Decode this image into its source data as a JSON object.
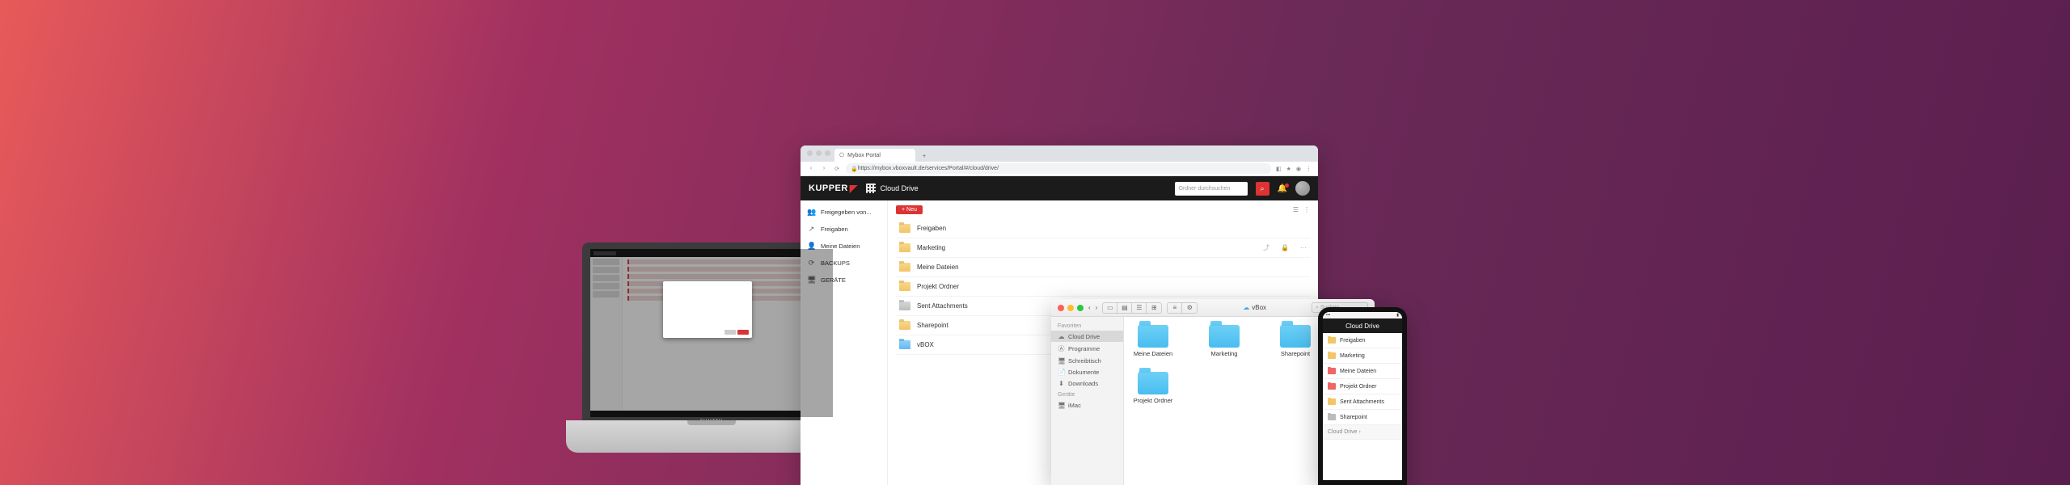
{
  "laptop": {
    "brand": "FUJITSU"
  },
  "browser": {
    "tab_title": "Mybox Portal",
    "url": "https://mybox.vboxvault.de/services/Portal/#/cloud/drive/",
    "window_controls": [
      "min",
      "max",
      "close"
    ]
  },
  "app": {
    "logo": "KUPPER",
    "title": "Cloud Drive",
    "search_placeholder": "Ordner durchsuchen",
    "new_button": "+ Neu"
  },
  "sidebar": {
    "items": [
      {
        "icon": "users",
        "label": "Freigegeben von..."
      },
      {
        "icon": "share",
        "label": "Freigaben"
      },
      {
        "icon": "user",
        "label": "Meine Dateien"
      },
      {
        "icon": "backup",
        "label": "BACKUPS"
      },
      {
        "icon": "device",
        "label": "GERÄTE"
      }
    ]
  },
  "files": [
    {
      "type": "folder",
      "name": "Freigaben",
      "shared": false
    },
    {
      "type": "folder",
      "name": "Marketing",
      "shared": true
    },
    {
      "type": "folder",
      "name": "Meine Dateien",
      "shared": false
    },
    {
      "type": "folder",
      "name": "Projekt Ordner",
      "shared": false
    },
    {
      "type": "folder",
      "name": "Sent Attachments",
      "shared": false,
      "color": "grey"
    },
    {
      "type": "folder",
      "name": "Sharepoint",
      "shared": false
    },
    {
      "type": "folder",
      "name": "vBOX",
      "shared": false,
      "color": "blue"
    }
  ],
  "finder": {
    "title": "vBox",
    "search_placeholder": "Suchen",
    "favorites_header": "Favoriten",
    "devices_header": "Geräte",
    "favorites": [
      {
        "icon": "cloud",
        "label": "Cloud Drive",
        "selected": true
      },
      {
        "icon": "app",
        "label": "Programme"
      },
      {
        "icon": "desk",
        "label": "Schreibtisch"
      },
      {
        "icon": "doc",
        "label": "Dokumente"
      },
      {
        "icon": "down",
        "label": "Downloads"
      }
    ],
    "devices": [
      {
        "icon": "mac",
        "label": "iMac"
      }
    ],
    "items": [
      "Meine Dateien",
      "Marketing",
      "Sharepoint",
      "Projekt Ordner"
    ]
  },
  "phone": {
    "title": "Cloud Drive",
    "items": [
      {
        "color": "y",
        "label": "Freigaben"
      },
      {
        "color": "y",
        "label": "Marketing"
      },
      {
        "color": "r",
        "label": "Meine Dateien"
      },
      {
        "color": "r",
        "label": "Projekt Ordner"
      },
      {
        "color": "y",
        "label": "Sent Attachments"
      },
      {
        "color": "g",
        "label": "Sharepoint"
      }
    ],
    "back_label": "Cloud Drive ›"
  }
}
